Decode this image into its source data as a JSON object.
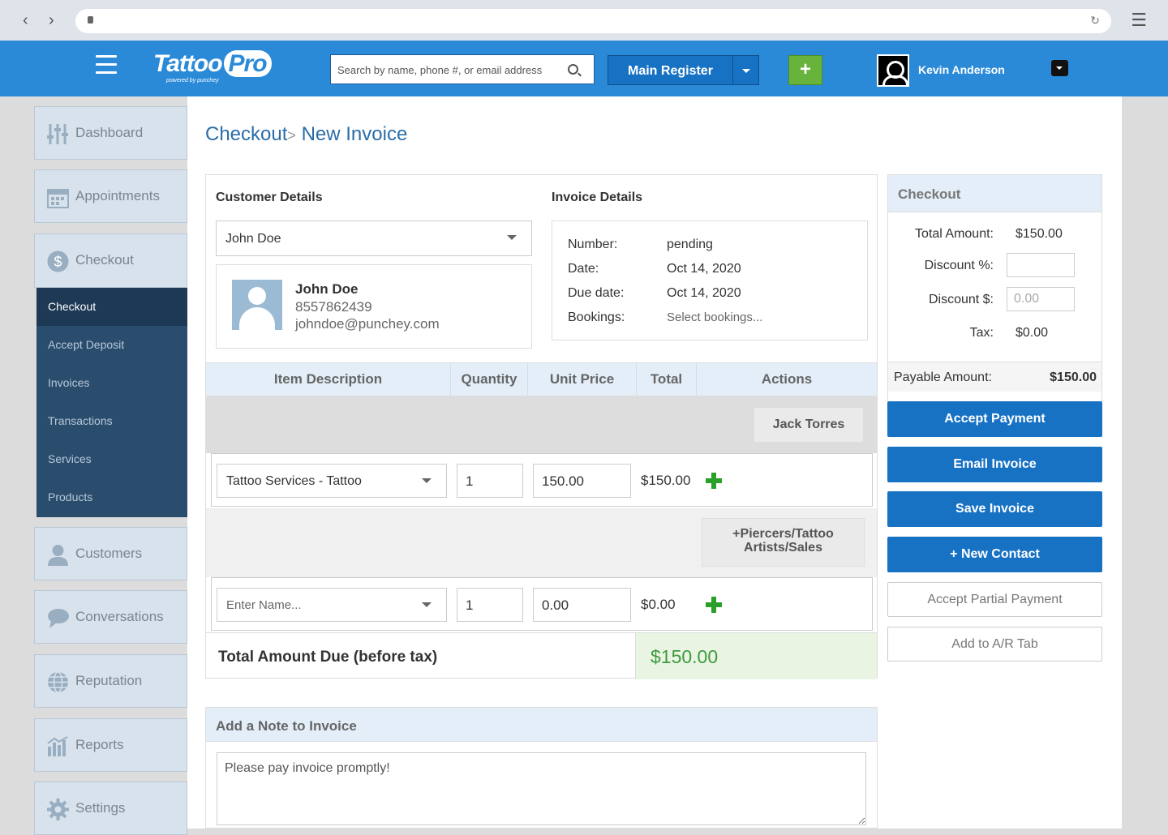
{
  "header": {
    "logo_main": "Tattoo",
    "logo_pro": "Pro",
    "logo_tagline": "powered by punchey",
    "search_placeholder": "Search by name, phone #, or email address",
    "register_label": "Main Register",
    "add_label": "+",
    "user_name": "Kevin Anderson"
  },
  "sidebar": {
    "items": [
      {
        "label": "Dashboard",
        "icon": "sliders-icon"
      },
      {
        "label": "Appointments",
        "icon": "calendar-icon"
      },
      {
        "label": "Checkout",
        "icon": "dollar-icon"
      },
      {
        "label": "Customers",
        "icon": "person-icon"
      },
      {
        "label": "Conversations",
        "icon": "chat-bubble-icon"
      },
      {
        "label": "Reputation",
        "icon": "globe-icon"
      },
      {
        "label": "Reports",
        "icon": "bar-chart-icon"
      },
      {
        "label": "Settings",
        "icon": "gear-icon"
      }
    ],
    "sub_items": [
      "Checkout",
      "Accept Deposit",
      "Invoices",
      "Transactions",
      "Services",
      "Products"
    ]
  },
  "breadcrumb": {
    "parent": "Checkout",
    "separator": ">",
    "current": "New Invoice"
  },
  "customer": {
    "heading": "Customer Details",
    "selected": "John Doe",
    "name": "John Doe",
    "phone": "8557862439",
    "email": "johndoe@punchey.com"
  },
  "invoice": {
    "heading": "Invoice Details",
    "number_label": "Number:",
    "number": "pending",
    "date_label": "Date:",
    "date": "Oct 14, 2020",
    "due_label": "Due date:",
    "due": "Oct 14, 2020",
    "bookings_label": "Bookings:",
    "bookings": "Select bookings..."
  },
  "table": {
    "columns": [
      "Item Description",
      "Quantity",
      "Unit Price",
      "Total",
      "Actions"
    ],
    "artist_button": "Jack Torres",
    "item": {
      "description": "Tattoo Services - Tattoo",
      "quantity": "1",
      "unit_price": "150.00",
      "total": "$150.00"
    },
    "add_artist_button": "+Piercers/Tattoo Artists/Sales",
    "new_item": {
      "placeholder": "Enter Name...",
      "quantity": "1",
      "unit_price": "0.00",
      "total": "$0.00"
    },
    "total_label": "Total Amount Due (before tax)",
    "total_value": "$150.00"
  },
  "note": {
    "heading": "Add a Note to Invoice",
    "text": "Please pay invoice promptly!"
  },
  "checkout": {
    "heading": "Checkout",
    "total_label": "Total Amount:",
    "total": "$150.00",
    "discount_pct_label": "Discount %:",
    "discount_pct": "",
    "discount_amt_label": "Discount $:",
    "discount_amt_placeholder": "0.00",
    "tax_label": "Tax:",
    "tax": "$0.00",
    "payable_label": "Payable Amount:",
    "payable": "$150.00"
  },
  "actions": {
    "accept_payment": "Accept Payment",
    "email_invoice": "Email Invoice",
    "save_invoice": "Save Invoice",
    "new_contact": "+ New Contact",
    "accept_partial": "Accept Partial Payment",
    "add_ar_tab": "Add to A/R Tab"
  },
  "colors": {
    "brand_blue": "#2b8ad8",
    "button_blue": "#1872c4",
    "success_green": "#3e9b3e",
    "add_green": "#67b33c"
  }
}
